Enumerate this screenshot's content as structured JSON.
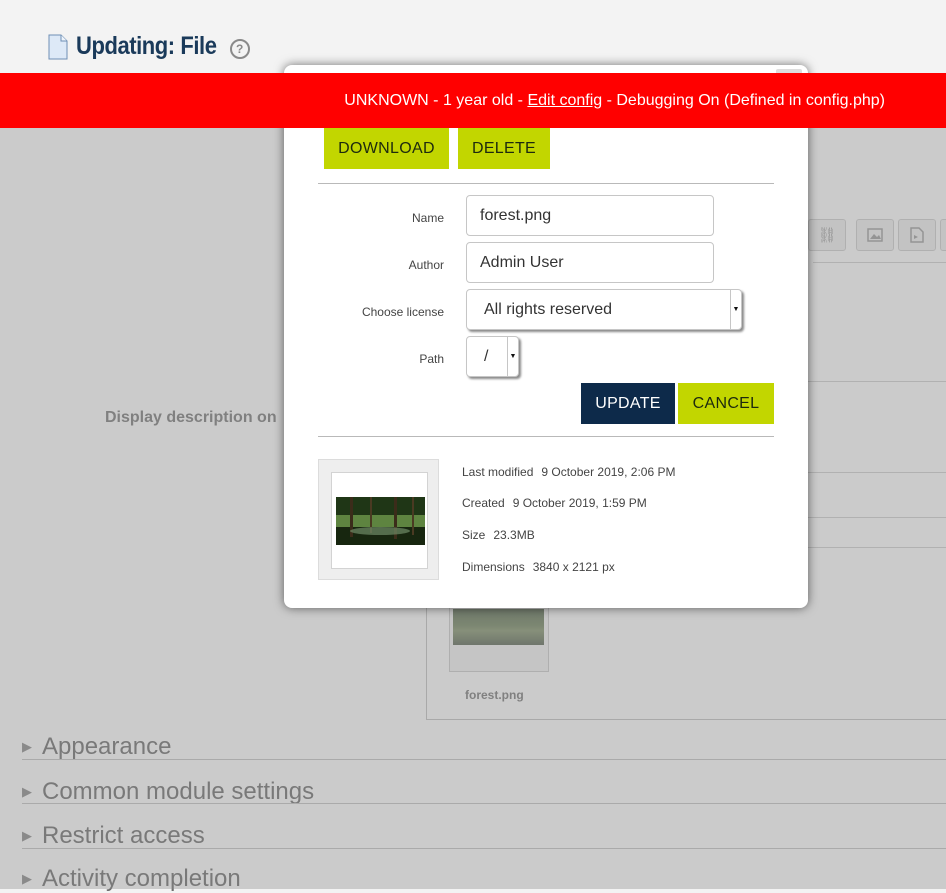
{
  "page": {
    "title": "Updating: File"
  },
  "background": {
    "display_label": "Display description on",
    "thumb_filename": "forest.png",
    "sections": [
      {
        "label": "Appearance"
      },
      {
        "label": "Common module settings"
      },
      {
        "label": "Restrict access"
      },
      {
        "label": "Activity completion"
      }
    ]
  },
  "debug_banner": {
    "prefix": "UNKNOWN - 1 year old - ",
    "link": "Edit config",
    "suffix": " - Debugging On (Defined in config.php)"
  },
  "dialog": {
    "download_label": "DOWNLOAD",
    "delete_label": "DELETE",
    "fields": {
      "name_label": "Name",
      "name_value": "forest.png",
      "author_label": "Author",
      "author_value": "Admin User",
      "license_label": "Choose license",
      "license_value": "All rights reserved",
      "path_label": "Path",
      "path_value": "/"
    },
    "update_label": "UPDATE",
    "cancel_label": "CANCEL",
    "meta": {
      "last_modified_label": "Last modified",
      "last_modified_value": "9 October 2019, 2:06 PM",
      "created_label": "Created",
      "created_value": "9 October 2019, 1:59 PM",
      "size_label": "Size",
      "size_value": "23.3MB",
      "dimensions_label": "Dimensions",
      "dimensions_value": "3840 x 2121 px"
    }
  }
}
